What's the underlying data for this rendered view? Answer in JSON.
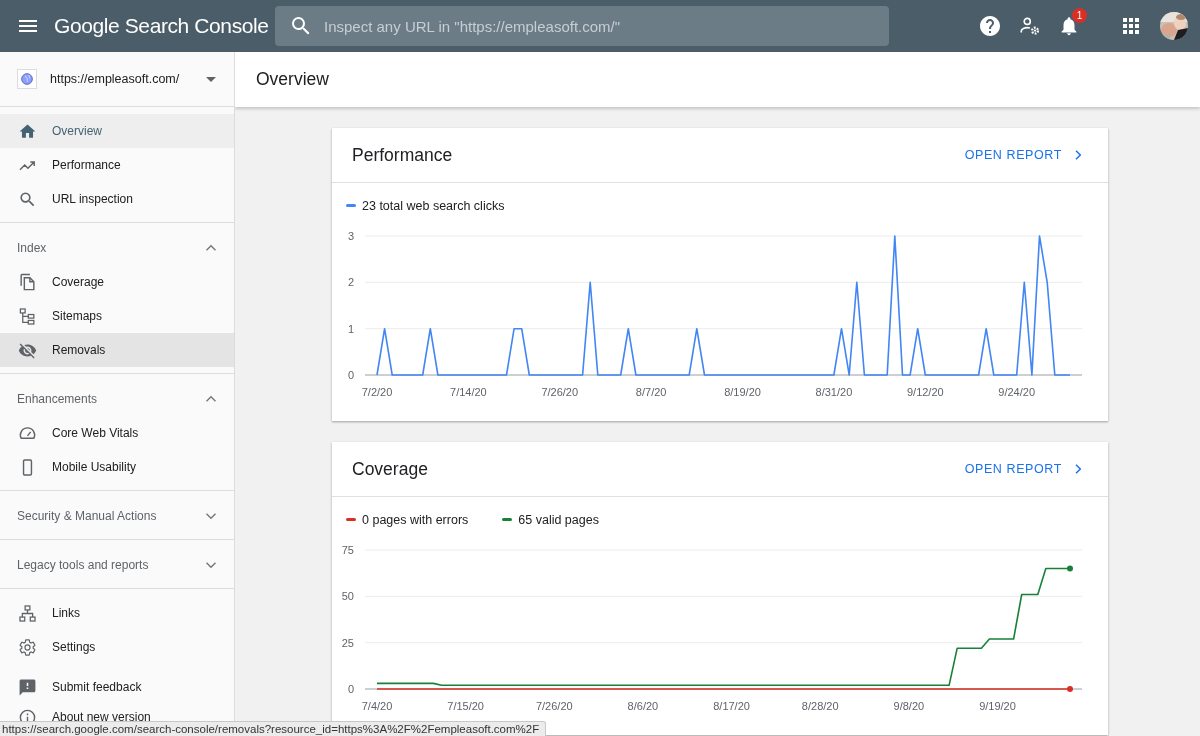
{
  "top_bar": {
    "app_title": "Google Search Console",
    "search": {
      "placeholder": "Inspect any URL in \"https://empleasoft.com/\""
    },
    "notifications": {
      "badge": "1"
    }
  },
  "property": {
    "url": "https://empleasoft.com/"
  },
  "sidebar": {
    "groups": [
      {
        "kind": "nav",
        "items": [
          {
            "label": "Overview",
            "selected": true,
            "hovered": false
          },
          {
            "label": "Performance",
            "selected": false,
            "hovered": false
          },
          {
            "label": "URL inspection",
            "selected": false,
            "hovered": false
          }
        ]
      },
      {
        "kind": "nav",
        "header": {
          "label": "Index",
          "expanded": true
        },
        "items": [
          {
            "label": "Coverage",
            "selected": false,
            "hovered": false
          },
          {
            "label": "Sitemaps",
            "selected": false,
            "hovered": false
          },
          {
            "label": "Removals",
            "selected": false,
            "hovered": true
          }
        ]
      },
      {
        "kind": "nav",
        "header": {
          "label": "Enhancements",
          "expanded": true
        },
        "items": [
          {
            "label": "Core Web Vitals",
            "selected": false,
            "hovered": false
          },
          {
            "label": "Mobile Usability",
            "selected": false,
            "hovered": false
          }
        ]
      },
      {
        "kind": "nav",
        "header": {
          "label": "Security & Manual Actions",
          "expanded": false
        }
      },
      {
        "kind": "nav",
        "header": {
          "label": "Legacy tools and reports",
          "expanded": false
        }
      },
      {
        "kind": "nav",
        "items": [
          {
            "label": "Links",
            "selected": false,
            "hovered": false
          },
          {
            "label": "Settings",
            "selected": false,
            "hovered": false
          }
        ]
      },
      {
        "kind": "footer",
        "items": [
          {
            "label": "Submit feedback",
            "selected": false,
            "hovered": false
          },
          {
            "label": "About new version",
            "selected": false,
            "hovered": false
          }
        ]
      }
    ]
  },
  "page": {
    "title": "Overview"
  },
  "cards": [
    {
      "title": "Performance",
      "action": "OPEN REPORT",
      "end_dots": false,
      "chart_data": {
        "type": "line",
        "ylim": [
          0,
          3
        ],
        "yticks": [
          0,
          1,
          2,
          3
        ],
        "categories": [
          "7/2/20",
          null,
          null,
          null,
          null,
          null,
          null,
          null,
          null,
          null,
          null,
          null,
          "7/14/20",
          null,
          null,
          null,
          null,
          null,
          null,
          null,
          null,
          null,
          null,
          null,
          "7/26/20",
          null,
          null,
          null,
          null,
          null,
          null,
          null,
          null,
          null,
          null,
          null,
          "8/7/20",
          null,
          null,
          null,
          null,
          null,
          null,
          null,
          null,
          null,
          null,
          null,
          "8/19/20",
          null,
          null,
          null,
          null,
          null,
          null,
          null,
          null,
          null,
          null,
          null,
          "8/31/20",
          null,
          null,
          null,
          null,
          null,
          null,
          null,
          null,
          null,
          null,
          null,
          "9/12/20",
          null,
          null,
          null,
          null,
          null,
          null,
          null,
          null,
          null,
          null,
          null,
          "9/24/20",
          null,
          null,
          null,
          null,
          null,
          null,
          null
        ],
        "series": [
          {
            "name": "23 total web search clicks",
            "color": "#4285f4",
            "values": [
              0,
              1,
              0,
              0,
              0,
              0,
              0,
              1,
              0,
              0,
              0,
              0,
              0,
              0,
              0,
              0,
              0,
              0,
              1,
              1,
              0,
              0,
              0,
              0,
              0,
              0,
              0,
              0,
              2,
              0,
              0,
              0,
              0,
              1,
              0,
              0,
              0,
              0,
              0,
              0,
              0,
              0,
              1,
              0,
              0,
              0,
              0,
              0,
              0,
              0,
              0,
              0,
              0,
              0,
              0,
              0,
              0,
              0,
              0,
              0,
              0,
              1,
              0,
              2,
              0,
              0,
              0,
              0,
              3,
              0,
              0,
              1,
              0,
              0,
              0,
              0,
              0,
              0,
              0,
              0,
              1,
              0,
              0,
              0,
              0,
              2,
              0,
              3,
              2,
              0,
              0,
              0
            ]
          }
        ]
      }
    },
    {
      "title": "Coverage",
      "action": "OPEN REPORT",
      "end_dots": true,
      "chart_data": {
        "type": "line",
        "ylim": [
          0,
          75
        ],
        "yticks": [
          0,
          25,
          50,
          75
        ],
        "categories": [
          "7/4/20",
          null,
          null,
          null,
          null,
          null,
          null,
          null,
          null,
          null,
          null,
          "7/15/20",
          null,
          null,
          null,
          null,
          null,
          null,
          null,
          null,
          null,
          null,
          "7/26/20",
          null,
          null,
          null,
          null,
          null,
          null,
          null,
          null,
          null,
          null,
          "8/6/20",
          null,
          null,
          null,
          null,
          null,
          null,
          null,
          null,
          null,
          null,
          "8/17/20",
          null,
          null,
          null,
          null,
          null,
          null,
          null,
          null,
          null,
          null,
          "8/28/20",
          null,
          null,
          null,
          null,
          null,
          null,
          null,
          null,
          null,
          null,
          "9/8/20",
          null,
          null,
          null,
          null,
          null,
          null,
          null,
          null,
          null,
          null,
          "9/19/20",
          null,
          null,
          null,
          null,
          null,
          null,
          null,
          null,
          null
        ],
        "series": [
          {
            "name": "0 pages with errors",
            "color": "#d93025",
            "values": [
              0,
              0,
              0,
              0,
              0,
              0,
              0,
              0,
              0,
              0,
              0,
              0,
              0,
              0,
              0,
              0,
              0,
              0,
              0,
              0,
              0,
              0,
              0,
              0,
              0,
              0,
              0,
              0,
              0,
              0,
              0,
              0,
              0,
              0,
              0,
              0,
              0,
              0,
              0,
              0,
              0,
              0,
              0,
              0,
              0,
              0,
              0,
              0,
              0,
              0,
              0,
              0,
              0,
              0,
              0,
              0,
              0,
              0,
              0,
              0,
              0,
              0,
              0,
              0,
              0,
              0,
              0,
              0,
              0,
              0,
              0,
              0,
              0,
              0,
              0,
              0,
              0,
              0,
              0,
              0,
              0,
              0,
              0,
              0,
              0,
              0,
              0
            ]
          },
          {
            "name": "65 valid pages",
            "color": "#188038",
            "values": [
              3,
              3,
              3,
              3,
              3,
              3,
              3,
              3,
              2,
              2,
              2,
              2,
              2,
              2,
              2,
              2,
              2,
              2,
              2,
              2,
              2,
              2,
              2,
              2,
              2,
              2,
              2,
              2,
              2,
              2,
              2,
              2,
              2,
              2,
              2,
              2,
              2,
              2,
              2,
              2,
              2,
              2,
              2,
              2,
              2,
              2,
              2,
              2,
              2,
              2,
              2,
              2,
              2,
              2,
              2,
              2,
              2,
              2,
              2,
              2,
              2,
              2,
              2,
              2,
              2,
              2,
              2,
              2,
              2,
              2,
              2,
              2,
              22,
              22,
              22,
              22,
              27,
              27,
              27,
              27,
              51,
              51,
              51,
              65,
              65,
              65,
              65
            ]
          }
        ]
      }
    }
  ],
  "status_url": "https://search.google.com/search-console/removals?resource_id=https%3A%2F%2Fempleasoft.com%2F"
}
